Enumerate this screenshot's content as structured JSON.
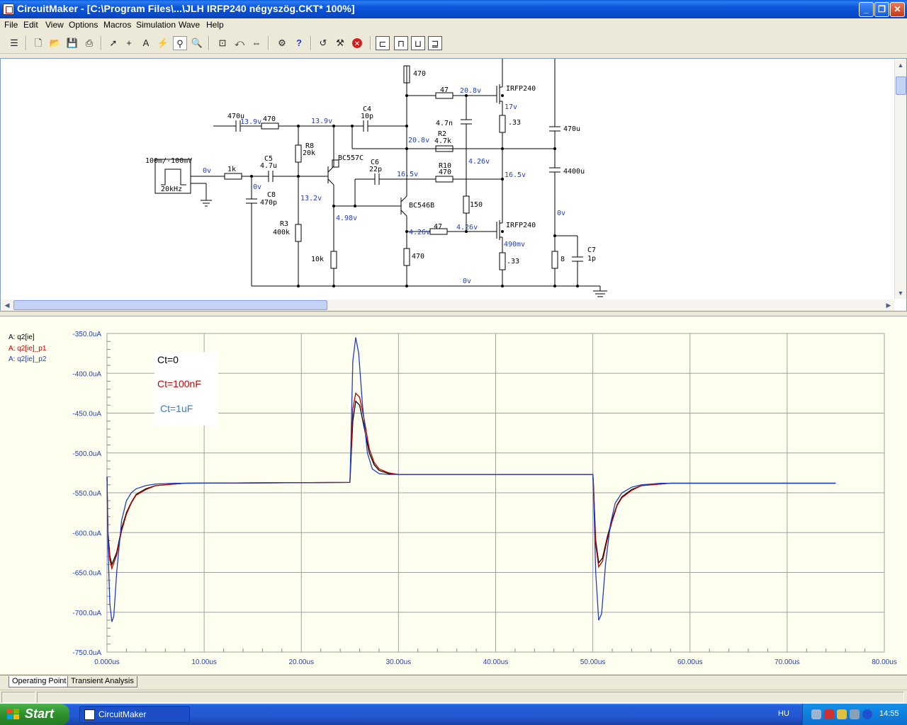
{
  "window": {
    "title": "CircuitMaker - [C:\\Program Files\\...\\JLH IRFP240 négyszög.CKT* 100%]"
  },
  "menu": [
    "File",
    "Edit",
    "View",
    "Options",
    "Macros",
    "Simulation",
    "Wave",
    "Help"
  ],
  "toolbar": {
    "icons": [
      "new-icon",
      "open-icon",
      "save-icon",
      "print-icon",
      "arrow-icon",
      "wire-icon",
      "text-icon",
      "probe-icon",
      "zoom-icon",
      "zoom-fit-icon",
      "rotate-icon",
      "mirror-icon",
      "run-icon",
      "help-icon",
      "undo-icon",
      "tool-icon",
      "stop-icon",
      "digital-icon",
      "analog-icon",
      "trace-icon",
      "step-icon"
    ]
  },
  "schematic": {
    "labels": [
      {
        "t": "470u"
      },
      {
        "t": "13.9v"
      },
      {
        "t": "470"
      },
      {
        "t": "13.9v"
      },
      {
        "t": "C4"
      },
      {
        "t": "10p"
      },
      {
        "t": "470"
      },
      {
        "t": "47"
      },
      {
        "t": "20.8v"
      },
      {
        "t": "IRFP240"
      },
      {
        "t": "17v"
      },
      {
        "t": "4.7n"
      },
      {
        "t": ".33"
      },
      {
        "t": "470u"
      },
      {
        "t": "R8"
      },
      {
        "t": "20k"
      },
      {
        "t": "20.8v"
      },
      {
        "t": "R2"
      },
      {
        "t": "4.7k"
      },
      {
        "t": "100m/-100mV"
      },
      {
        "t": "BC557C"
      },
      {
        "t": "C6"
      },
      {
        "t": "22p"
      },
      {
        "t": "4.26v"
      },
      {
        "t": "0v"
      },
      {
        "t": "1k"
      },
      {
        "t": "C5"
      },
      {
        "t": "4.7u"
      },
      {
        "t": "16.5v"
      },
      {
        "t": "R10"
      },
      {
        "t": "470"
      },
      {
        "t": "16.5v"
      },
      {
        "t": "4400u"
      },
      {
        "t": "20kHz"
      },
      {
        "t": "0v"
      },
      {
        "t": "C8"
      },
      {
        "t": "470p"
      },
      {
        "t": "13.2v"
      },
      {
        "t": "BC546B"
      },
      {
        "t": "150"
      },
      {
        "t": "0v"
      },
      {
        "t": "R3"
      },
      {
        "t": "400k"
      },
      {
        "t": "4.98v"
      },
      {
        "t": "4.26v"
      },
      {
        "t": "47"
      },
      {
        "t": "4.26v"
      },
      {
        "t": "IRFP240"
      },
      {
        "t": "490mv"
      },
      {
        "t": "C7"
      },
      {
        "t": "1p"
      },
      {
        "t": "8"
      },
      {
        "t": "10k"
      },
      {
        "t": "470"
      },
      {
        "t": ".33"
      },
      {
        "t": "0v"
      }
    ]
  },
  "legend": [
    {
      "label": "A: q2[ie]",
      "color": "#000000"
    },
    {
      "label": "A: q2[ie]_p1",
      "color": "#c00000"
    },
    {
      "label": "A: q2[ie]_p2",
      "color": "#1e3cc8"
    }
  ],
  "annotations": [
    {
      "text": "Ct=0",
      "color": "#000000"
    },
    {
      "text": "Ct=100nF",
      "color": "#d00000"
    },
    {
      "text": "Ct=1uF",
      "color": "#2a7fd8"
    }
  ],
  "chart_data": {
    "type": "line",
    "x_ticks": [
      "0.000us",
      "10.00us",
      "20.00us",
      "30.00us",
      "40.00us",
      "50.00us",
      "60.00us",
      "70.00us",
      "80.00us"
    ],
    "y_ticks": [
      "-350.0uA",
      "-400.0uA",
      "-450.0uA",
      "-500.0uA",
      "-550.0uA",
      "-600.0uA",
      "-650.0uA",
      "-700.0uA",
      "-750.0uA"
    ],
    "xlim": [
      0,
      80
    ],
    "ylim": [
      -750,
      -350
    ],
    "x_unit": "us",
    "y_unit": "uA",
    "grid": true,
    "series": [
      {
        "name": "A: q2[ie]",
        "color": "#000000",
        "x": [
          0,
          0.1,
          0.3,
          0.5,
          1,
          1.5,
          2,
          2.5,
          3,
          4,
          5,
          7,
          8,
          25,
          25.05,
          25.3,
          25.6,
          26,
          26.5,
          27,
          27.5,
          28,
          29,
          30,
          31,
          50,
          50.05,
          50.3,
          50.6,
          51,
          51.5,
          52,
          52.5,
          53,
          54,
          55,
          57,
          58
        ],
        "y": [
          -530,
          -600,
          -630,
          -640,
          -625,
          -595,
          -575,
          -562,
          -552,
          -545,
          -541,
          -539,
          -538,
          -537,
          -525,
          -460,
          -435,
          -440,
          -470,
          -500,
          -515,
          -522,
          -526,
          -527,
          -527,
          -527,
          -535,
          -610,
          -638,
          -632,
          -605,
          -583,
          -565,
          -555,
          -546,
          -541,
          -539,
          -538
        ]
      },
      {
        "name": "A: q2[ie]_p1",
        "color": "#c00000",
        "x": [
          0,
          0.1,
          0.3,
          0.5,
          1,
          1.5,
          2,
          2.5,
          3,
          4,
          5,
          7,
          8,
          25,
          25.05,
          25.3,
          25.6,
          26,
          26.5,
          27,
          27.5,
          28,
          29,
          30,
          31,
          50,
          50.05,
          50.3,
          50.6,
          51,
          51.5,
          52,
          52.5,
          53,
          54,
          55,
          57,
          58
        ],
        "y": [
          -530,
          -605,
          -635,
          -645,
          -628,
          -598,
          -577,
          -563,
          -553,
          -546,
          -541,
          -539,
          -538,
          -537,
          -522,
          -445,
          -425,
          -430,
          -460,
          -495,
          -512,
          -520,
          -525,
          -527,
          -527,
          -527,
          -535,
          -615,
          -643,
          -636,
          -608,
          -585,
          -566,
          -556,
          -547,
          -541,
          -539,
          -538
        ]
      },
      {
        "name": "A: q2[ie]_p2",
        "color": "#1e3cc8",
        "x": [
          0,
          0.1,
          0.3,
          0.5,
          0.7,
          1,
          1.5,
          2,
          2.5,
          3,
          4,
          5,
          7,
          8,
          25,
          25.05,
          25.3,
          25.6,
          25.9,
          26.3,
          26.8,
          27.3,
          28,
          29,
          30,
          31,
          50,
          50.05,
          50.3,
          50.6,
          50.9,
          51.3,
          51.8,
          52.3,
          53,
          54,
          55,
          57,
          58
        ],
        "y": [
          -530,
          -620,
          -690,
          -712,
          -705,
          -650,
          -585,
          -560,
          -550,
          -545,
          -541,
          -539,
          -538,
          -538,
          -537,
          -515,
          -385,
          -355,
          -375,
          -440,
          -500,
          -520,
          -526,
          -527,
          -527,
          -527,
          -527,
          -540,
          -650,
          -710,
          -702,
          -640,
          -590,
          -563,
          -550,
          -543,
          -540,
          -538,
          -538
        ]
      }
    ]
  },
  "tabs": [
    "Operating Point",
    "Transient Analysis"
  ],
  "taskbar": {
    "start": "Start",
    "task": "CircuitMaker",
    "lang": "HU",
    "clock": "14:55"
  }
}
